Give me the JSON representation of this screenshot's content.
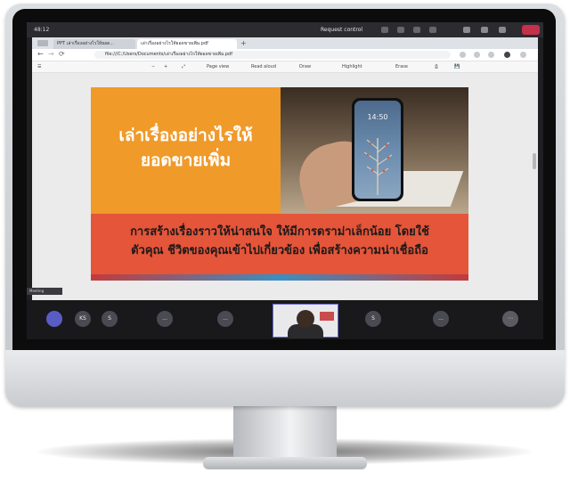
{
  "app_bar": {
    "timer": "48:12",
    "request_control": "Request control"
  },
  "browser": {
    "tabs": [
      {
        "label": "PPT เล่าเรื่องอย่างไรให้ยอด..."
      },
      {
        "label": "เล่าเรื่องอย่างไรให้ยอดขายเพิ่ม.pdf"
      }
    ],
    "address": "file:///C:/Users/Documents/เล่าเรื่องอย่างไรให้ยอดขายเพิ่ม.pdf",
    "toolbar": {
      "page_view": "Page view",
      "read_aloud": "Read aloud",
      "draw": "Draw",
      "highlight": "Highlight",
      "erase": "Erase"
    }
  },
  "slide": {
    "title_line1": "เล่าเรื่องอย่างไรให้",
    "title_line2": "ยอดขายเพิ่ม",
    "body_line1": "การสร้างเรื่องราวให้น่าสนใจ ให้มีการดราม่าเล็กน้อย โดยใช้",
    "body_line2": "ตัวคุณ ชีวิตของคุณเข้าไปเกี่ยวข้อง เพื่อสร้างความน่าเชื่อถือ",
    "phone_time": "14:50"
  },
  "participants": [
    {
      "initials": "KS"
    },
    {
      "initials": "S"
    },
    {
      "initials": "..."
    },
    {
      "initials": "..."
    },
    {
      "initials": "S"
    },
    {
      "initials": "..."
    }
  ],
  "left_panel_tag": "Meeting"
}
